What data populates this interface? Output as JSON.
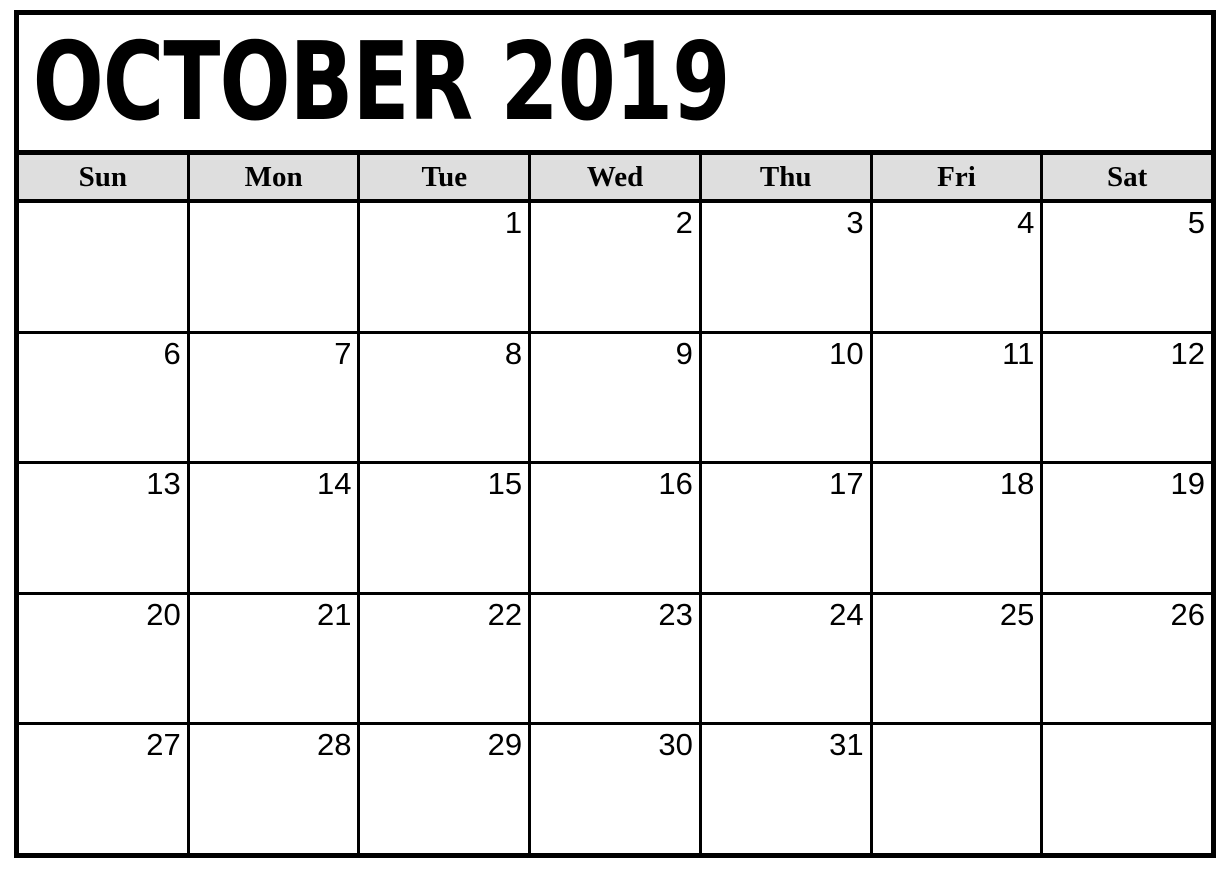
{
  "calendar": {
    "title": "OCTOBER 2019",
    "month": "October",
    "year": "2019",
    "weekday_headers": [
      "Sun",
      "Mon",
      "Tue",
      "Wed",
      "Thu",
      "Fri",
      "Sat"
    ],
    "weeks": [
      [
        "",
        "",
        "1",
        "2",
        "3",
        "4",
        "5"
      ],
      [
        "6",
        "7",
        "8",
        "9",
        "10",
        "11",
        "12"
      ],
      [
        "13",
        "14",
        "15",
        "16",
        "17",
        "18",
        "19"
      ],
      [
        "20",
        "21",
        "22",
        "23",
        "24",
        "25",
        "26"
      ],
      [
        "27",
        "28",
        "29",
        "30",
        "31",
        "",
        ""
      ]
    ],
    "colors": {
      "border": "#000000",
      "header_background": "#dedede",
      "cell_background": "#ffffff",
      "text": "#000000",
      "page_background": "#ffffff"
    }
  }
}
